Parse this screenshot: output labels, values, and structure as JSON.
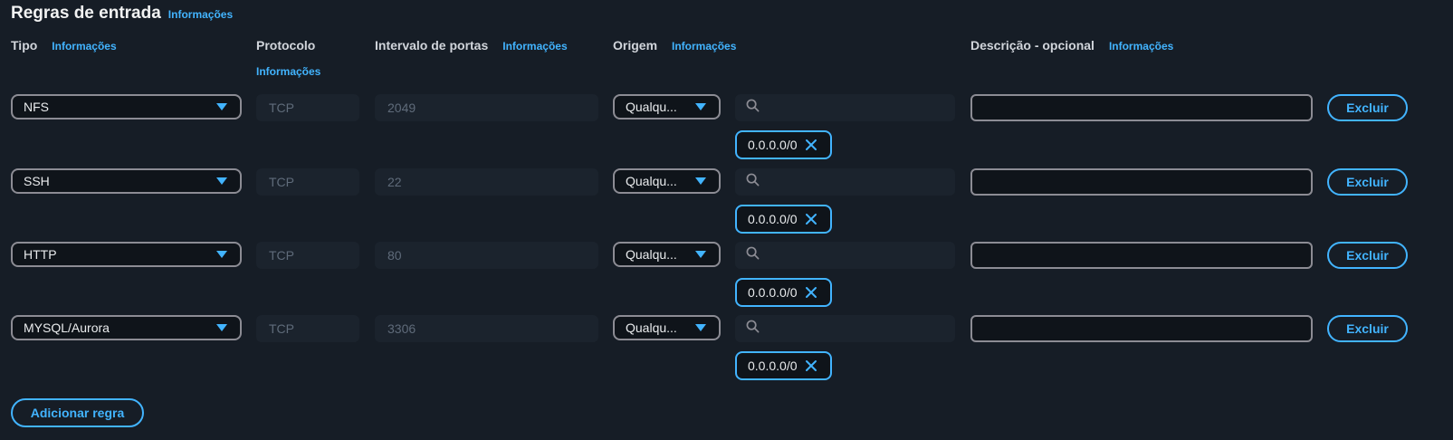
{
  "section": {
    "title": "Regras de entrada",
    "info": "Informações"
  },
  "headers": {
    "type": {
      "label": "Tipo",
      "info": "Informações"
    },
    "protocol": {
      "label": "Protocolo",
      "info": "Informações"
    },
    "port_range": {
      "label": "Intervalo de portas",
      "info": "Informações"
    },
    "source": {
      "label": "Origem",
      "info": "Informações"
    },
    "description": {
      "label": "Descrição - opcional",
      "info": "Informações"
    }
  },
  "rules": [
    {
      "type": "NFS",
      "protocol": "TCP",
      "port": "2049",
      "source_mode": "Qualqu...",
      "cidr": "0.0.0.0/0",
      "delete_label": "Excluir"
    },
    {
      "type": "SSH",
      "protocol": "TCP",
      "port": "22",
      "source_mode": "Qualqu...",
      "cidr": "0.0.0.0/0",
      "delete_label": "Excluir"
    },
    {
      "type": "HTTP",
      "protocol": "TCP",
      "port": "80",
      "source_mode": "Qualqu...",
      "cidr": "0.0.0.0/0",
      "delete_label": "Excluir"
    },
    {
      "type": "MYSQL/Aurora",
      "protocol": "TCP",
      "port": "3306",
      "source_mode": "Qualqu...",
      "cidr": "0.0.0.0/0",
      "delete_label": "Excluir"
    }
  ],
  "add_rule_label": "Adicionar regra",
  "colors": {
    "background": "#161d26",
    "accent": "#42b4ff",
    "border": "#8c8c94"
  },
  "icons": {
    "dropdown": "caret-down-icon",
    "search": "search-icon",
    "remove": "close-icon"
  }
}
